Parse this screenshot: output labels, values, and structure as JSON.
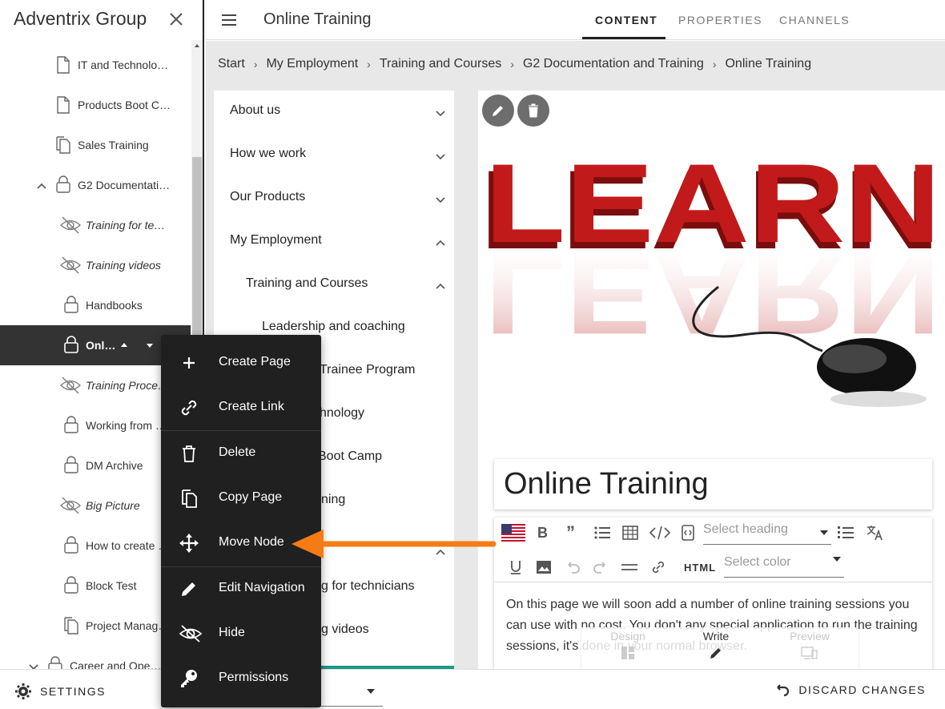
{
  "app": {
    "brand": "Adventrix Group",
    "page_title": "Online Training"
  },
  "tabs": [
    {
      "label": "CONTENT",
      "active": true
    },
    {
      "label": "PROPERTIES",
      "active": false
    },
    {
      "label": "CHANNELS",
      "active": false
    }
  ],
  "breadcrumb": [
    "Start",
    "My Employment",
    "Training and Courses",
    "G2 Documentation and Training",
    "Online Training"
  ],
  "sidebar": {
    "items": [
      {
        "label": "IT and Technolo…",
        "icon": "page-icon"
      },
      {
        "label": "Products Boot C…",
        "icon": "page-icon"
      },
      {
        "label": "Sales Training",
        "icon": "copy-page-icon"
      },
      {
        "label": "G2 Documentati…",
        "icon": "lock-icon"
      },
      {
        "label": "Training for te…",
        "icon": "hidden-eye-icon"
      },
      {
        "label": "Training videos",
        "icon": "hidden-eye-icon"
      },
      {
        "label": "Handbooks",
        "icon": "lock-icon"
      },
      {
        "label": "Onli…",
        "icon": "lock-icon"
      },
      {
        "label": "Training Proce…",
        "icon": "hidden-eye-icon"
      },
      {
        "label": "Working from …",
        "icon": "lock-icon"
      },
      {
        "label": "DM Archive",
        "icon": "lock-icon"
      },
      {
        "label": "Big Picture",
        "icon": "hidden-eye-icon"
      },
      {
        "label": "How to create …",
        "icon": "lock-icon"
      },
      {
        "label": "Block Test",
        "icon": "lock-icon"
      },
      {
        "label": "Project Manag…",
        "icon": "copy-page-icon"
      },
      {
        "label": "Career and Open…",
        "icon": "lock-icon"
      }
    ]
  },
  "nav": {
    "items": [
      {
        "label": "About us"
      },
      {
        "label": "How we work"
      },
      {
        "label": "Our Products"
      },
      {
        "label": "My Employment"
      },
      {
        "label": "Training and Courses"
      },
      {
        "label": "Leadership and coaching"
      },
      {
        "label": "Trainee Program"
      },
      {
        "label": "hnology"
      },
      {
        "label": "Boot Camp"
      },
      {
        "label": "ning"
      },
      {
        "label": "g for technicians"
      },
      {
        "label": "g videos"
      }
    ]
  },
  "context_menu": {
    "items": [
      {
        "label": "Create Page",
        "icon": "plus-icon"
      },
      {
        "label": "Create Link",
        "icon": "link-icon"
      },
      {
        "label": "Delete",
        "icon": "trash-icon"
      },
      {
        "label": "Copy Page",
        "icon": "copy-icon"
      },
      {
        "label": "Move Node",
        "icon": "move-icon"
      },
      {
        "label": "Edit Navigation",
        "icon": "pencil-icon"
      },
      {
        "label": "Hide",
        "icon": "hidden-eye-icon"
      },
      {
        "label": "Permissions",
        "icon": "key-icon"
      }
    ]
  },
  "editor": {
    "title": "Online Training",
    "heading_placeholder": "Select heading",
    "color_placeholder": "Select color",
    "html_label": "HTML",
    "body": "On this page we will soon add a number of online training sessions you can use with no cost. You don't any special application to run the training sessions, it's done in your normal browser."
  },
  "modes": [
    {
      "label": "Design",
      "active": false
    },
    {
      "label": "Write",
      "active": true
    },
    {
      "label": "Preview",
      "active": false
    }
  ],
  "bottom": {
    "settings_label": "SETTINGS",
    "discard_label": "DISCARD CHANGES"
  },
  "colors": {
    "accent_teal": "#1a9a86",
    "annotation_orange": "#f57c14",
    "menu_bg": "#202020",
    "selected_row": "#333333"
  }
}
